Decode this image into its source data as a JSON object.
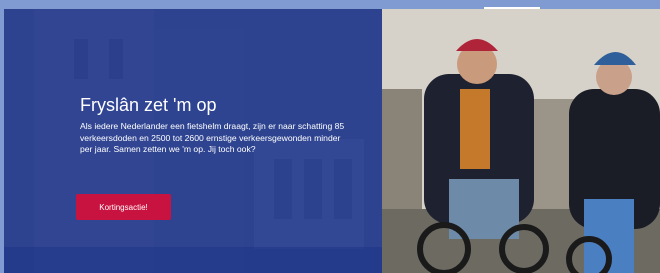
{
  "hero": {
    "title": "Fryslân zet 'm op",
    "body": "Als iedere Nederlander een fietshelm draagt, zijn er naar schatting 85 verkeersdoden en 2500 tot 2600 ernstige verkeersgewonden minder per jaar. Samen zetten we 'm op. Jij toch ook?",
    "cta_label": "Kortingsactie!"
  },
  "colors": {
    "overlay": "#2a44a0",
    "cta": "#c8123f",
    "frame": "#7f9bd1"
  }
}
